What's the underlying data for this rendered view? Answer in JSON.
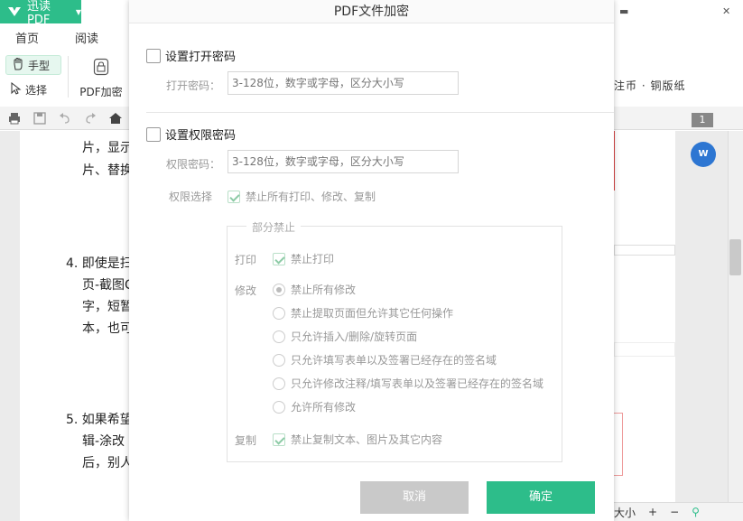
{
  "app": {
    "brand": "迅读PDF",
    "tabs": [
      "首页",
      "阅读"
    ],
    "tools": {
      "hand": "手型",
      "select": "选择",
      "pdf_encrypt": "PDF加密"
    },
    "ribbon_right_partial": "注币  ·  铜版纸",
    "page_number": "1",
    "status": {
      "zoom_label": "大小",
      "plus": "+",
      "minus": "−"
    },
    "accent_color": "#2dbd8a"
  },
  "document": {
    "lines": [
      "片，显示",
      "片、替换",
      "4. 即使是扫",
      "页-截图C",
      "字，短暂",
      "本，也可",
      "5. 如果希望",
      "辑-涂改",
      "后，别人"
    ]
  },
  "dialog": {
    "title": "PDF文件加密",
    "open_password": {
      "checkbox_label": "设置打开密码",
      "field_label": "打开密码：",
      "placeholder": "3-128位，数字或字母，区分大小写"
    },
    "permission_password": {
      "checkbox_label": "设置权限密码",
      "field_label": "权限密码：",
      "placeholder": "3-128位，数字或字母，区分大小写",
      "choice_label": "权限选择",
      "ban_all_label": "禁止所有打印、修改、复制"
    },
    "partial": {
      "legend": "部分禁止",
      "print_label": "打印",
      "print_option": "禁止打印",
      "modify_label": "修改",
      "modify_options": [
        "禁止所有修改",
        "禁止提取页面但允许其它任何操作",
        "只允许插入/删除/旋转页面",
        "只允许填写表单以及签署已经存在的签名域",
        "只允许修改注释/填写表单以及签署已经存在的签名域",
        "允许所有修改"
      ],
      "modify_selected_index": 0,
      "copy_label": "复制",
      "copy_option": "禁止复制文本、图片及其它内容"
    },
    "buttons": {
      "cancel": "取消",
      "ok": "确定"
    }
  }
}
